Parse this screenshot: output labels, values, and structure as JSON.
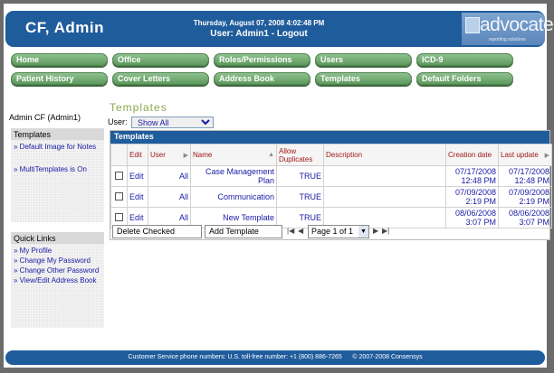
{
  "header": {
    "user_title": "CF, Admin",
    "datetime": "Thursday, August 07, 2008 4:02:48 PM",
    "user_line": "User: Admin1",
    "separator": " - ",
    "logout_label": "Logout",
    "logo_text": "advocate",
    "logo_subtext": "reporting solutions"
  },
  "nav": {
    "row1": [
      "Home",
      "Office",
      "Roles/Permissions",
      "Users",
      "ICD-9"
    ],
    "row2": [
      "Patient History",
      "Cover Letters",
      "Address Book",
      "Templates",
      "Default Folders"
    ]
  },
  "sidebar": {
    "admin_name": "Admin CF (Admin1)",
    "templates_title": "Templates",
    "templates_links": [
      "» Default Image for Notes",
      "» MultiTemplates is On"
    ],
    "quick_links_title": "Quick Links",
    "quick_links": [
      "» My Profile",
      "» Change My Password",
      "» Change Other Password",
      "» View/Edit Address Book"
    ]
  },
  "main": {
    "page_title": "Templates",
    "filter_label": "User:",
    "filter_value": "Show All",
    "grid_title": "Templates",
    "columns": {
      "edit": "Edit",
      "user": "User",
      "name": "Name",
      "allow_dup": "Allow Duplicates",
      "description": "Description",
      "created": "Creation date",
      "updated": "Last update"
    },
    "rows": [
      {
        "edit": "Edit",
        "user": "All",
        "name": "Case Management Plan",
        "allow_dup": "TRUE",
        "description": "",
        "created": "07/17/2008 12:48 PM",
        "updated": "07/17/2008 12:48 PM"
      },
      {
        "edit": "Edit",
        "user": "All",
        "name": "Communication",
        "allow_dup": "TRUE",
        "description": "",
        "created": "07/09/2008 2:19 PM",
        "updated": "07/09/2008 2:19 PM"
      },
      {
        "edit": "Edit",
        "user": "All",
        "name": "New Template",
        "allow_dup": "TRUE",
        "description": "",
        "created": "08/06/2008 3:07 PM",
        "updated": "08/06/2008 3:07 PM"
      }
    ],
    "delete_label": "Delete Checked",
    "add_label": "Add Template",
    "page_label": "Page 1 of 1"
  },
  "footer": {
    "text": "Customer Service phone numbers: U.S. toll-free number: +1 (800) 886-7265      © 2007-2008 Consensys"
  }
}
